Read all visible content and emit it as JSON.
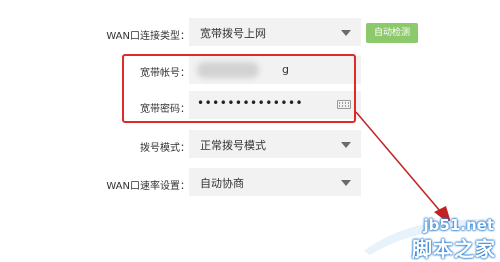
{
  "form": {
    "wan_type": {
      "label": "WAN口连接类型：",
      "value": "宽带拨号上网",
      "auto_detect_label": "自动检测"
    },
    "account": {
      "label": "宽带帐号：",
      "value_visible_suffix": "g"
    },
    "password": {
      "label": "宽带密码：",
      "masked_value": "••••••••••••••"
    },
    "dial_mode": {
      "label": "拨号模式：",
      "value": "正常拨号模式"
    },
    "speed": {
      "label": "WAN口速率设置：",
      "value": "自动协商"
    }
  },
  "colors": {
    "highlight": "#e02a2a",
    "auto_button": "#8cc96a",
    "input_bg": "#f2f2f2"
  },
  "watermark": {
    "site": "jb51.net",
    "name": "脚本之家"
  }
}
